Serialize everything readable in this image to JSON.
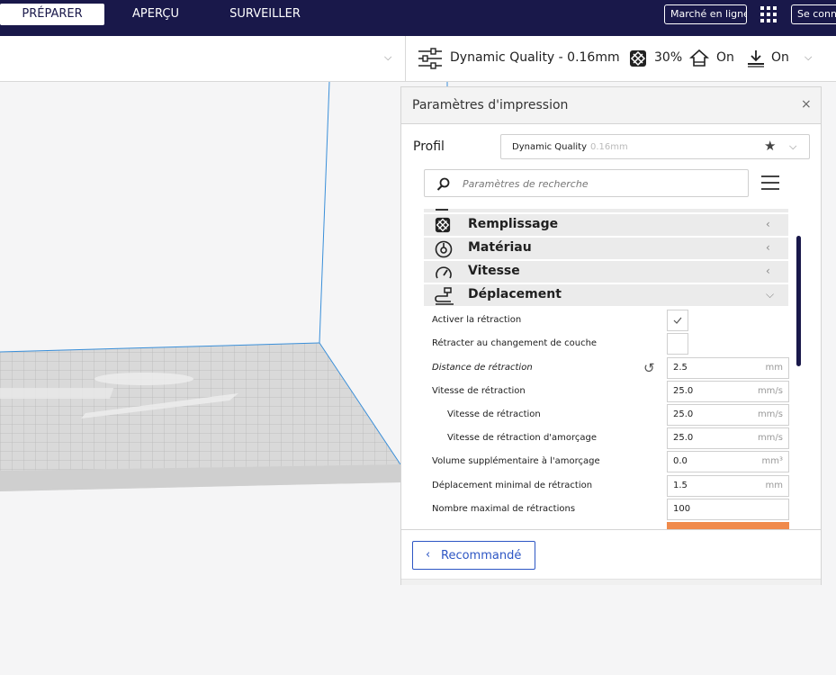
{
  "topbar": {
    "tabs": [
      {
        "label": "PRÉPARER",
        "active": true
      },
      {
        "label": "APERÇU",
        "active": false
      },
      {
        "label": "SURVEILLER",
        "active": false
      }
    ],
    "marketplace_label": "Marché en ligne",
    "signin_label": "Se connecter",
    "background_color": "#19184a"
  },
  "stage": {
    "quality_label": "Dynamic Quality - 0.16mm",
    "infill_value": "30%",
    "support_value": "On",
    "adhesion_value": "On"
  },
  "panel": {
    "title": "Paramètres d'impression",
    "profile_label": "Profil",
    "profile_name": "Dynamic Quality",
    "profile_sub": "0.16mm",
    "search_placeholder": "Paramètres de recherche",
    "categories": [
      {
        "label": "Remplissage",
        "icon": "infill-icon",
        "expanded": false
      },
      {
        "label": "Matériau",
        "icon": "material-icon",
        "expanded": false
      },
      {
        "label": "Vitesse",
        "icon": "speed-icon",
        "expanded": false
      },
      {
        "label": "Déplacement",
        "icon": "travel-icon",
        "expanded": true
      }
    ],
    "settings": [
      {
        "label": "Activer la rétraction",
        "type": "checkbox",
        "checked": true
      },
      {
        "label": "Rétracter au changement de couche",
        "type": "checkbox",
        "checked": false
      },
      {
        "label": "Distance de rétraction",
        "type": "number",
        "value": "2.5",
        "unit": "mm"
      },
      {
        "label": "Vitesse de rétraction",
        "type": "number",
        "value": "25.0",
        "unit": "mm/s"
      },
      {
        "label": "Vitesse de rétraction",
        "type": "number",
        "value": "25.0",
        "unit": "mm/s"
      },
      {
        "label": "Vitesse de rétraction d'amorçage",
        "type": "number",
        "value": "25.0",
        "unit": "mm/s"
      },
      {
        "label": "Volume supplémentaire à l'amorçage",
        "type": "number",
        "value": "0.0",
        "unit": "mm³"
      },
      {
        "label": "Déplacement minimal de rétraction",
        "type": "number",
        "value": "1.5",
        "unit": "mm"
      },
      {
        "label": "Nombre maximal de rétractions",
        "type": "number",
        "value": "100",
        "unit": ""
      }
    ],
    "recommended_label": "Recommandé",
    "accent_color": "#2d56c4",
    "highlight_color": "#f08a4b"
  }
}
